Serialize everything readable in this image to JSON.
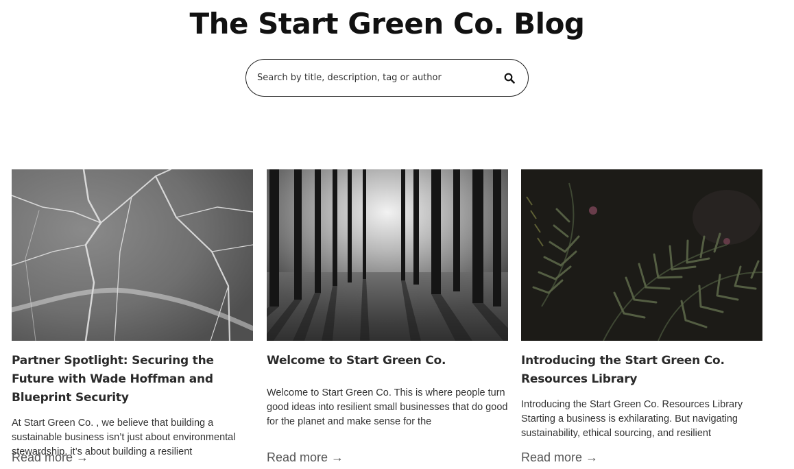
{
  "header": {
    "title": "The Start Green Co. Blog"
  },
  "search": {
    "placeholder": "Search by title, description, tag or author",
    "icon": "search-icon"
  },
  "posts": [
    {
      "title": "Partner Spotlight: Securing the Future with Wade Hoffman and Blueprint Security",
      "excerpt": "At Start Green Co. , we believe that building a sustainable business isn’t just about environmental stewardship, it’s about building a resilient",
      "read_more": "Read more →"
    },
    {
      "title": "Welcome to Start Green Co.",
      "excerpt": "Welcome to Start Green Co. This is where people turn good ideas into resilient small businesses that do good for the planet and make sense for the",
      "read_more": "Read more →"
    },
    {
      "title": "Introducing the Start Green Co. Resources Library",
      "excerpt": "Introducing the Start Green Co. Resources Library Starting a business is exhilarating. But navigating sustainability, ethical sourcing, and resilient",
      "read_more": "Read more →"
    }
  ]
}
